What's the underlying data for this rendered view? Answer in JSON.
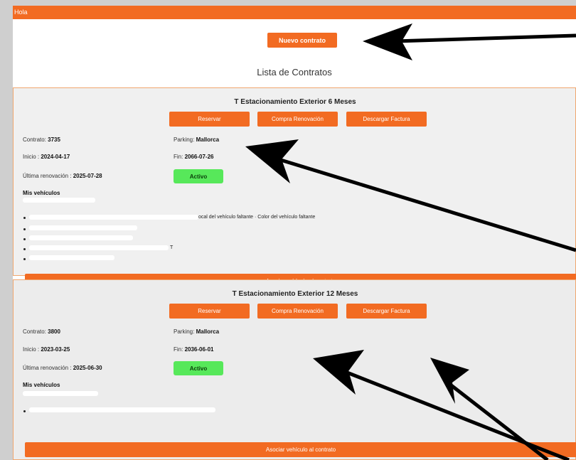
{
  "header": {
    "greeting": "Hola"
  },
  "actions": {
    "new_contract_label": "Nuevo contrato"
  },
  "list_title": "Lista de Contratos",
  "labels": {
    "contract": "Contrato: ",
    "parking": "Parking: ",
    "start": "Inicio : ",
    "end": "Fin: ",
    "last_renewal": "Última renovación : ",
    "my_vehicles": "Mis vehículos",
    "reserve": "Reservar",
    "renewal": "Compra Renovación",
    "invoice": "Descargar Factura",
    "associate": "Asociar vehículo al contrato"
  },
  "contracts": [
    {
      "title": "T Estacionamiento Exterior 6 Meses",
      "number": "3735",
      "parking": "Mallorca",
      "start": "2024-04-17",
      "end": "2066-07-26",
      "last_renewal": "2025-07-28",
      "status": "Activo",
      "vehicle_text_1": "ocal del vehículo faltante · Color del vehículo faltante",
      "vehicle_text_2": "T"
    },
    {
      "title": "T Estacionamiento Exterior 12 Meses",
      "number": "3800",
      "parking": "Mallorca",
      "start": "2023-03-25",
      "end": "2036-06-01",
      "last_renewal": "2025-06-30",
      "status": "Activo"
    }
  ],
  "colors": {
    "accent": "#f26b22",
    "status": "#57e85a",
    "arrow": "#000000"
  }
}
